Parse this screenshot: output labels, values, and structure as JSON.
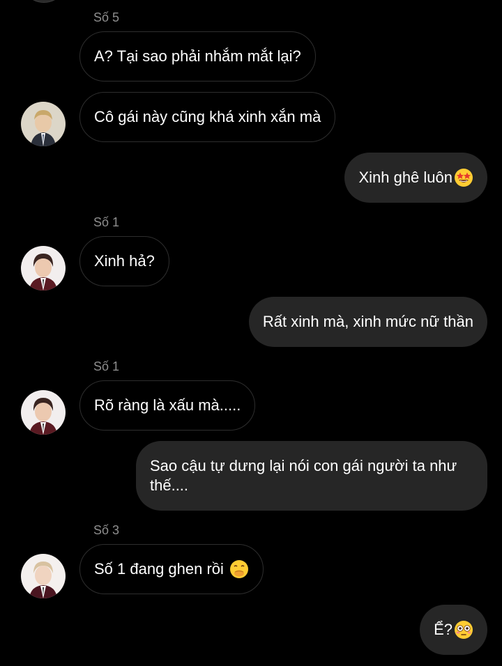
{
  "chat": {
    "messages": [
      {
        "sender": "Số 5",
        "text": "A? Tại sao phải nhắm mắt lại?"
      },
      {
        "text": "Cô gái này cũng khá xinh xắn mà"
      },
      {
        "text": "Xinh ghê luôn",
        "emoji": "star-struck-emoji"
      },
      {
        "sender": "Số 1",
        "text": "Xinh hả?"
      },
      {
        "text": "Rất xinh mà, xinh mức nữ thần"
      },
      {
        "sender": "Số 1",
        "text": "Rõ ràng là xấu mà....."
      },
      {
        "text": "Sao cậu tự dưng lại nói con gái người ta như thế...."
      },
      {
        "sender": "Số 3",
        "text": "Số 1 đang ghen rồi",
        "emoji": "hand-over-mouth-emoji"
      },
      {
        "text": "Ể?",
        "emoji": "flushed-emoji"
      }
    ]
  },
  "colors": {
    "background": "#000000",
    "incoming_border": "#2e2e2e",
    "outgoing_bubble": "#262626",
    "sender_label": "#8e8e8e",
    "text": "#ffffff"
  }
}
